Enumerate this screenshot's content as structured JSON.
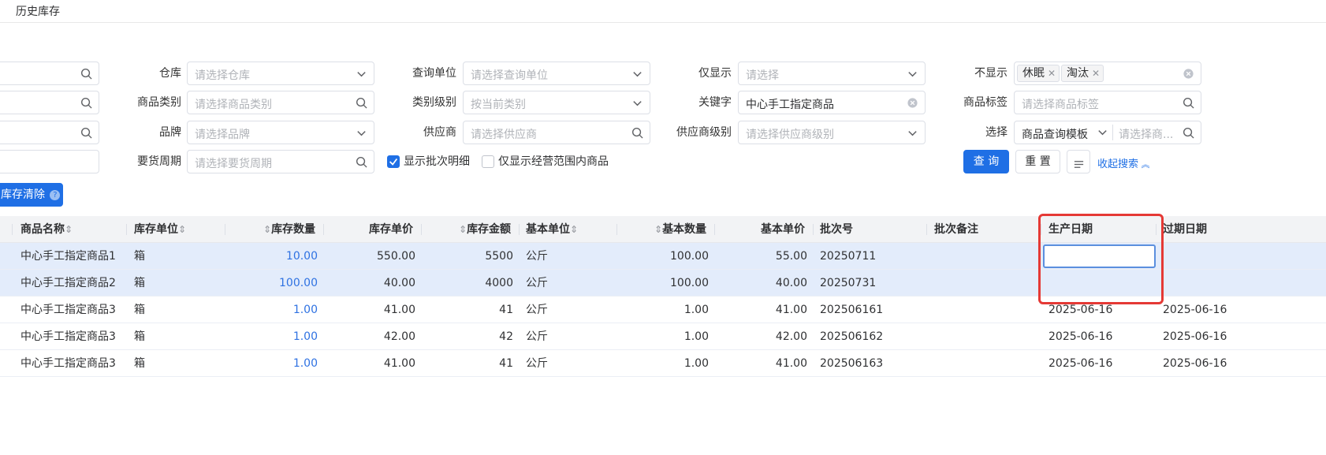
{
  "page_tab": "历史库存",
  "filters": {
    "warehouse": {
      "label": "仓库",
      "placeholder": "请选择仓库"
    },
    "query_unit": {
      "label": "查询单位",
      "placeholder": "请选择查询单位"
    },
    "only_show": {
      "label": "仅显示",
      "placeholder": "请选择"
    },
    "hide": {
      "label": "不显示",
      "tags": [
        "休眠",
        "淘汰"
      ]
    },
    "category": {
      "label": "商品类别",
      "placeholder": "请选择商品类别"
    },
    "category_level": {
      "label": "类别级别",
      "placeholder": "按当前类别"
    },
    "keyword": {
      "label": "关键字",
      "value": "中心手工指定商品"
    },
    "product_tag": {
      "label": "商品标签",
      "placeholder": "请选择商品标签"
    },
    "brand": {
      "label": "品牌",
      "placeholder": "请选择品牌"
    },
    "supplier": {
      "label": "供应商",
      "placeholder": "请选择供应商"
    },
    "supplier_level": {
      "label": "供应商级别",
      "placeholder": "请选择供应商级别"
    },
    "select": {
      "label": "选择",
      "value": "商品查询模板",
      "placeholder": "请选择商..."
    },
    "replenish_cycle": {
      "label": "要货周期",
      "placeholder": "请选择要货周期"
    },
    "show_batch_detail": {
      "label": "显示批次明细",
      "checked": true
    },
    "only_business_scope": {
      "label": "仅显示经营范围内商品",
      "checked": false
    }
  },
  "buttons": {
    "query": "查 询",
    "reset": "重 置",
    "collapse": "收起搜索",
    "clear_stock": "库存清除"
  },
  "table": {
    "columns": [
      "商品名称",
      "库存单位",
      "库存数量",
      "库存单价",
      "库存金额",
      "基本单位",
      "基本数量",
      "基本单价",
      "批次号",
      "批次备注",
      "生产日期",
      "过期日期"
    ],
    "rows": [
      {
        "name": "中心手工指定商品1",
        "unit": "箱",
        "qty": "10.00",
        "price": "550.00",
        "amount": "5500",
        "base_unit": "公斤",
        "base_qty": "100.00",
        "base_price": "55.00",
        "batch": "20250711",
        "note": "",
        "prod_date": "",
        "exp_date": "",
        "selected": true
      },
      {
        "name": "中心手工指定商品2",
        "unit": "箱",
        "qty": "100.00",
        "price": "40.00",
        "amount": "4000",
        "base_unit": "公斤",
        "base_qty": "100.00",
        "base_price": "40.00",
        "batch": "20250731",
        "note": "",
        "prod_date": "",
        "exp_date": "",
        "selected": true
      },
      {
        "name": "中心手工指定商品3",
        "unit": "箱",
        "qty": "1.00",
        "price": "41.00",
        "amount": "41",
        "base_unit": "公斤",
        "base_qty": "1.00",
        "base_price": "41.00",
        "batch": "202506161",
        "note": "",
        "prod_date": "2025-06-16",
        "exp_date": "2025-06-16",
        "selected": false
      },
      {
        "name": "中心手工指定商品3",
        "unit": "箱",
        "qty": "1.00",
        "price": "42.00",
        "amount": "42",
        "base_unit": "公斤",
        "base_qty": "1.00",
        "base_price": "42.00",
        "batch": "202506162",
        "note": "",
        "prod_date": "2025-06-16",
        "exp_date": "2025-06-16",
        "selected": false
      },
      {
        "name": "中心手工指定商品3",
        "unit": "箱",
        "qty": "1.00",
        "price": "41.00",
        "amount": "41",
        "base_unit": "公斤",
        "base_qty": "1.00",
        "base_price": "41.00",
        "batch": "202506163",
        "note": "",
        "prod_date": "2025-06-16",
        "exp_date": "2025-06-16",
        "selected": false
      }
    ]
  },
  "colors": {
    "primary": "#1f6fe5",
    "selected_row": "#e3ecfb",
    "highlight_box": "#e53935",
    "qty_link": "#2f72e2"
  },
  "icons": [
    "search-icon",
    "chevron-down-icon",
    "clear-icon",
    "close-icon",
    "question-icon",
    "columns-settings-icon",
    "chevron-up-double-icon",
    "check-icon"
  ]
}
